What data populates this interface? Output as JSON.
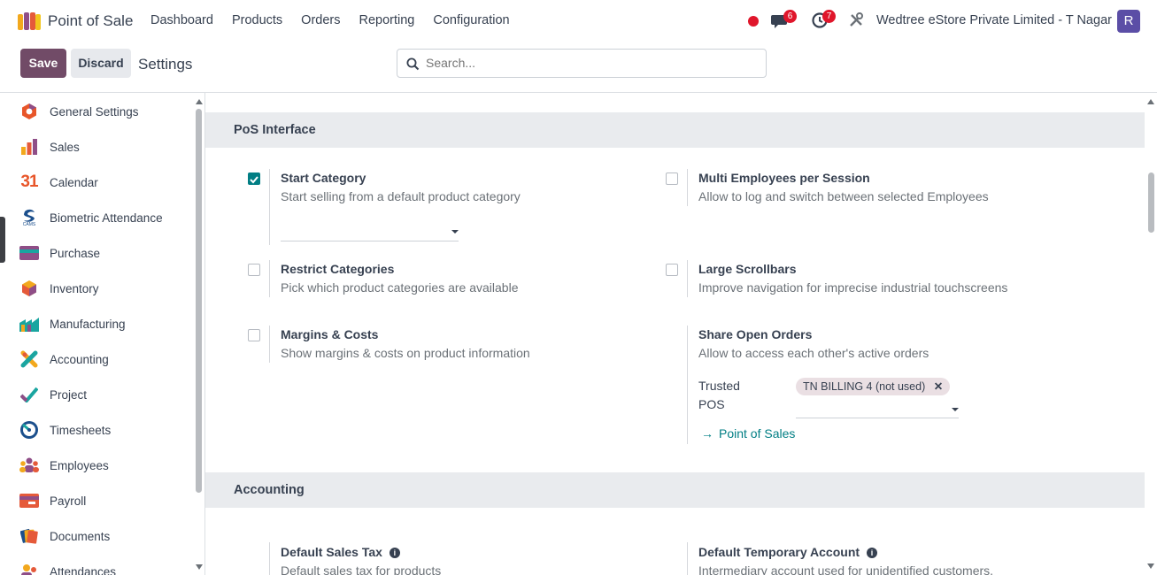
{
  "app": {
    "title": "Point of Sale"
  },
  "menu": [
    "Dashboard",
    "Products",
    "Orders",
    "Reporting",
    "Configuration"
  ],
  "systray": {
    "messages_count": "6",
    "activities_count": "7",
    "company": "Wedtree eStore Private Limited - T Nagar",
    "avatar_initial": "R"
  },
  "control": {
    "save_label": "Save",
    "discard_label": "Discard",
    "page_title": "Settings",
    "search_placeholder": "Search..."
  },
  "sidebar": {
    "items": [
      {
        "label": "General Settings",
        "icon": "general-settings-icon"
      },
      {
        "label": "Sales",
        "icon": "sales-icon"
      },
      {
        "label": "Calendar",
        "icon": "calendar-icon"
      },
      {
        "label": "Biometric Attendance",
        "icon": "biometric-attendance-icon"
      },
      {
        "label": "Purchase",
        "icon": "purchase-icon"
      },
      {
        "label": "Inventory",
        "icon": "inventory-icon"
      },
      {
        "label": "Manufacturing",
        "icon": "manufacturing-icon"
      },
      {
        "label": "Accounting",
        "icon": "accounting-icon"
      },
      {
        "label": "Project",
        "icon": "project-icon"
      },
      {
        "label": "Timesheets",
        "icon": "timesheets-icon"
      },
      {
        "label": "Employees",
        "icon": "employees-icon"
      },
      {
        "label": "Payroll",
        "icon": "payroll-icon"
      },
      {
        "label": "Documents",
        "icon": "documents-icon"
      },
      {
        "label": "Attendances",
        "icon": "attendances-icon"
      }
    ],
    "calendar_glyph": "31",
    "biometric_glyph": "CAMS"
  },
  "pos_interface": {
    "heading": "PoS Interface",
    "start_category": {
      "title": "Start Category",
      "desc": "Start selling from a default product category",
      "checked": true
    },
    "multi_employees": {
      "title": "Multi Employees per Session",
      "desc": "Allow to log and switch between selected Employees",
      "checked": false
    },
    "restrict_categories": {
      "title": "Restrict Categories",
      "desc": "Pick which product categories are available",
      "checked": false
    },
    "large_scrollbars": {
      "title": "Large Scrollbars",
      "desc": "Improve navigation for imprecise industrial touchscreens",
      "checked": false
    },
    "margins_costs": {
      "title": "Margins & Costs",
      "desc": "Show margins & costs on product information",
      "checked": false
    },
    "share_open_orders": {
      "title": "Share Open Orders",
      "desc": "Allow to access each other's active orders",
      "trusted_label_1": "Trusted",
      "trusted_label_2": "POS",
      "tag": "TN BILLING 4 (not used)",
      "link": "Point of Sales"
    }
  },
  "accounting": {
    "heading": "Accounting",
    "default_sales_tax": {
      "title": "Default Sales Tax",
      "desc": "Default sales tax for products"
    },
    "default_temp_account": {
      "title": "Default Temporary Account",
      "desc": "Intermediary account used for unidentified customers."
    }
  },
  "colors": {
    "brand": "#714b67",
    "teal": "#017e84",
    "badge": "#e0162b"
  }
}
